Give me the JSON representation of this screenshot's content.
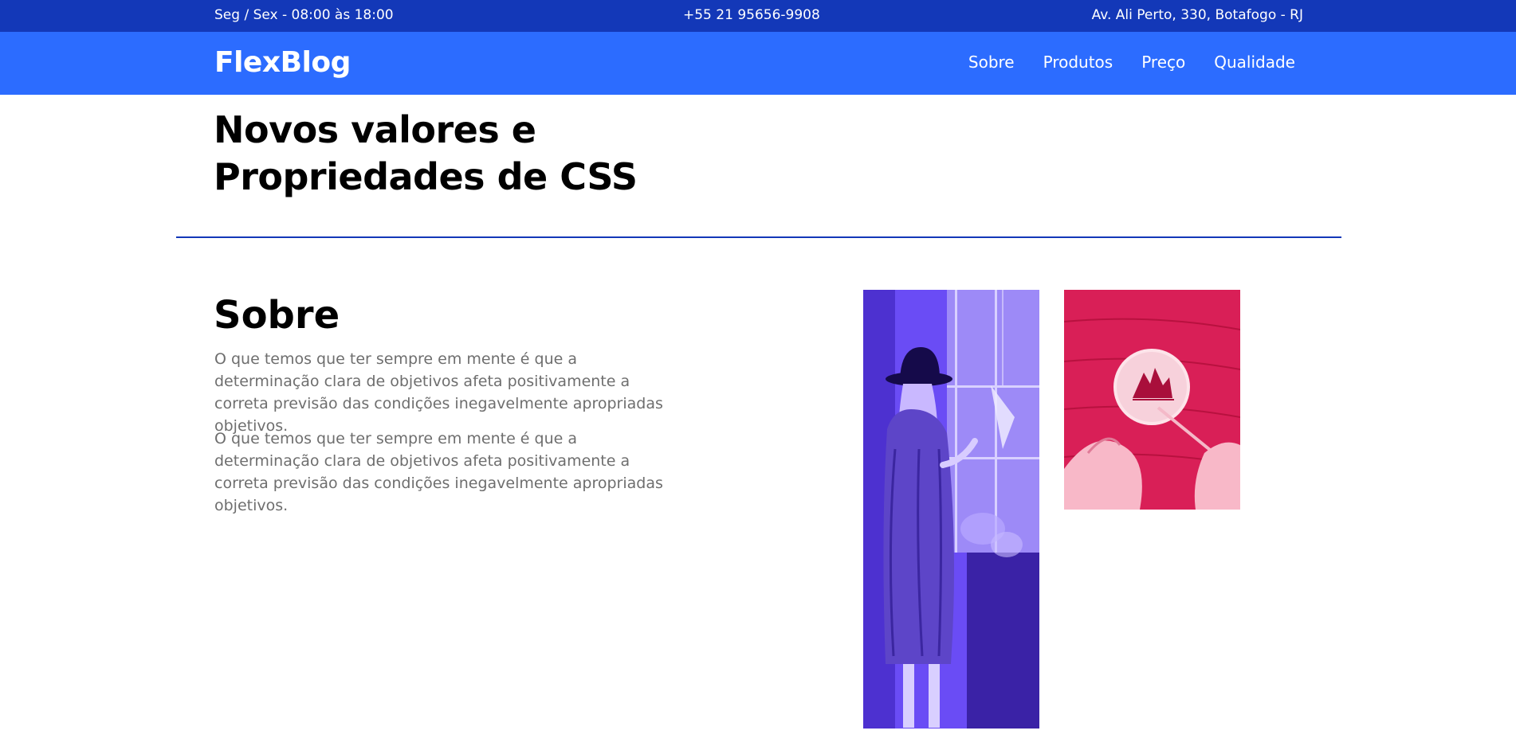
{
  "topbar": {
    "hours": "Seg / Sex - 08:00 às 18:00",
    "phone": "+55 21 95656-9908",
    "address": "Av. Ali Perto, 330, Botafogo - RJ"
  },
  "navbar": {
    "logo": "FlexBlog",
    "links": [
      "Sobre",
      "Produtos",
      "Preço",
      "Qualidade"
    ]
  },
  "hero": {
    "title_line1": "Novos valores e",
    "title_line2": "Propriedades de CSS"
  },
  "about": {
    "title": "Sobre",
    "paragraphs": [
      "O que temos que ter sempre em mente é que a determinação clara de objetivos afeta positivamente a correta previsão das condições inegavelmente apropriadas objetivos.",
      "O que temos que ter sempre em mente é que a determinação clara de objetivos afeta positivamente a correta previsão das condições inegavelmente apropriadas objetivos."
    ]
  },
  "colors": {
    "topbar": "#1338b8",
    "navbar": "#2c6cff",
    "divider": "#1338b8",
    "paragraph_text": "#6e6e6e",
    "photo_purple": "#5a3ae8",
    "photo_pink": "#d61e53"
  }
}
